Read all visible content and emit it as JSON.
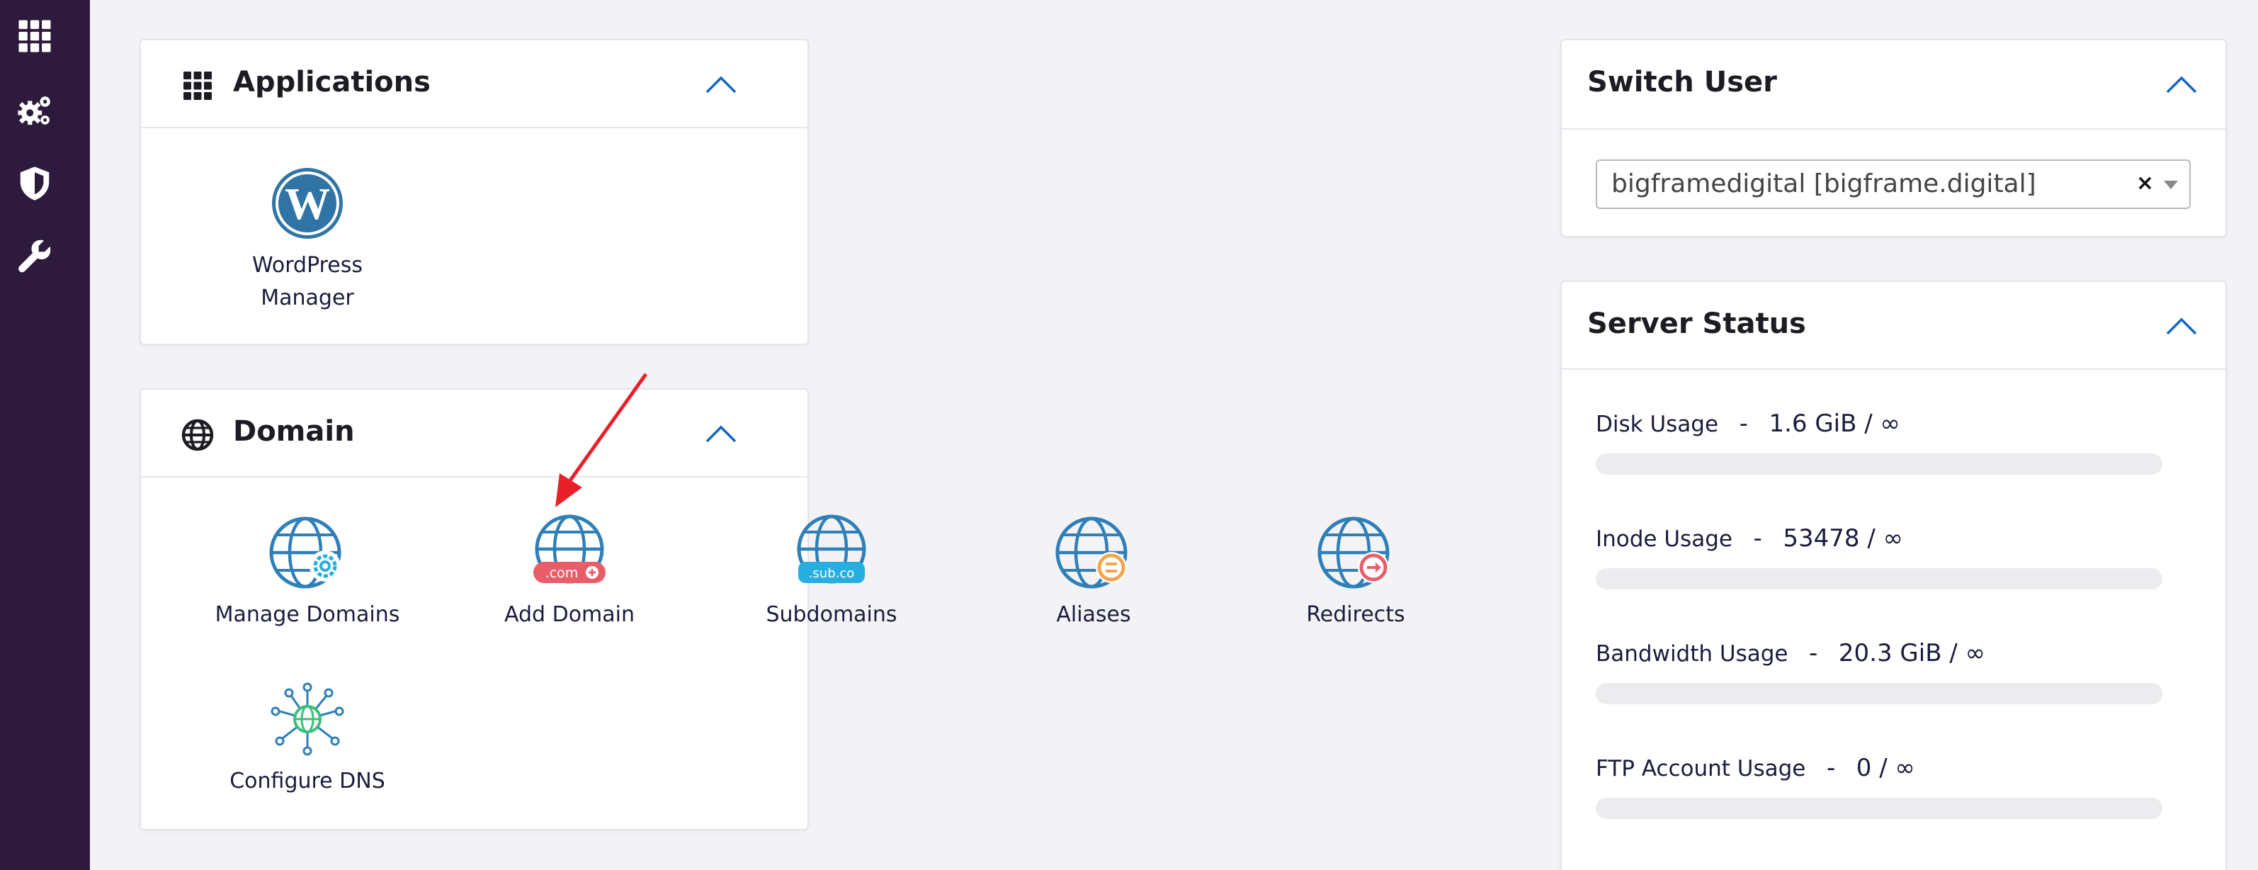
{
  "sidebar": {
    "items": [
      {
        "icon": "grid-icon"
      },
      {
        "icon": "gears-icon"
      },
      {
        "icon": "shield-icon"
      },
      {
        "icon": "wrench-icon"
      }
    ]
  },
  "applications": {
    "title": "Applications",
    "items": [
      {
        "label": "WordPress Manager",
        "icon": "wordpress-icon"
      }
    ]
  },
  "domain": {
    "title": "Domain",
    "items": [
      {
        "label": "Manage Domains",
        "icon": "globe-gear-icon"
      },
      {
        "label": "Add Domain",
        "icon": "globe-com-icon",
        "badge": ".com"
      },
      {
        "label": "Subdomains",
        "icon": "globe-sub-icon",
        "badge": ".sub.co"
      },
      {
        "label": "Aliases",
        "icon": "globe-alias-icon"
      },
      {
        "label": "Redirects",
        "icon": "globe-redirect-icon"
      },
      {
        "label": "Configure DNS",
        "icon": "dns-network-icon"
      }
    ]
  },
  "switch_user": {
    "title": "Switch User",
    "selected": "bigframedigital [bigframe.digital]",
    "clear": "×"
  },
  "server_status": {
    "title": "Server Status",
    "stats": [
      {
        "label": "Disk Usage",
        "sep": "-",
        "value": "1.6 GiB / ∞",
        "fill": 0
      },
      {
        "label": "Inode Usage",
        "sep": "-",
        "value": "53478 / ∞",
        "fill": 0
      },
      {
        "label": "Bandwidth Usage",
        "sep": "-",
        "value": "20.3 GiB / ∞",
        "fill": 0
      },
      {
        "label": "FTP Account Usage",
        "sep": "-",
        "value": "0 / ∞",
        "fill": 0
      }
    ]
  },
  "colors": {
    "sidebar_bg": "#2e1a3c",
    "accent_blue": "#1565c0",
    "globe_blue": "#2f7fb8",
    "badge_red": "#e95d6a",
    "badge_cyan": "#27aee0",
    "alias_orange": "#f5a44a",
    "annotation_red": "#e8202a"
  }
}
